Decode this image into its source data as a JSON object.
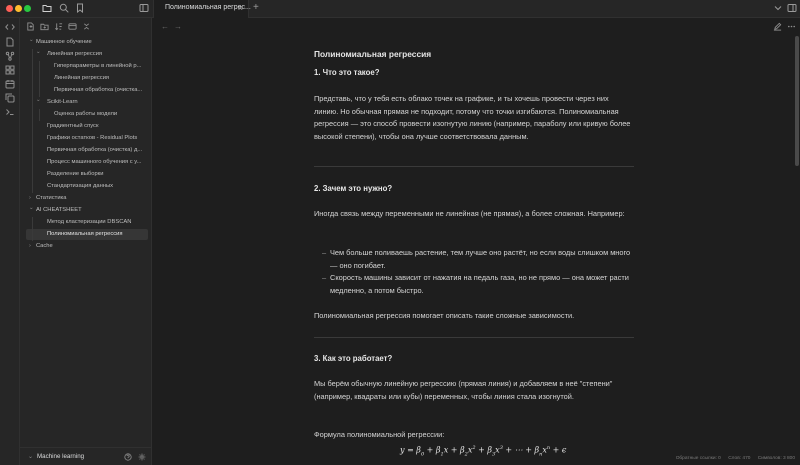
{
  "tab": {
    "title": "Полиномиальная регрес...",
    "close": "×",
    "add": "+"
  },
  "sidebar": {
    "tree": [
      {
        "label": "Машинное обучение",
        "level": 0,
        "folder": true,
        "open": true
      },
      {
        "label": "Линейная регрессия",
        "level": 1,
        "folder": true,
        "open": true
      },
      {
        "label": "Гиперпараметры в линейной р...",
        "level": 2,
        "folder": false
      },
      {
        "label": "Линейная регрессия",
        "level": 2,
        "folder": false
      },
      {
        "label": "Первичная обработка (очистка...",
        "level": 2,
        "folder": false
      },
      {
        "label": "Scikit-Learn",
        "level": 1,
        "folder": true,
        "open": true
      },
      {
        "label": "Оценка работы модели",
        "level": 2,
        "folder": false
      },
      {
        "label": "Градиентный спуск",
        "level": 1,
        "folder": false
      },
      {
        "label": "Графики остатков - Residual Plots",
        "level": 1,
        "folder": false
      },
      {
        "label": "Первичная обработка (очистка) д...",
        "level": 1,
        "folder": false
      },
      {
        "label": "Процесс машинного обучения с у...",
        "level": 1,
        "folder": false
      },
      {
        "label": "Разделение выборки",
        "level": 1,
        "folder": false
      },
      {
        "label": "Стандартизация данных",
        "level": 1,
        "folder": false
      },
      {
        "label": "Статистика",
        "level": 0,
        "folder": true,
        "open": false
      },
      {
        "label": "AI CHEATSHEET",
        "level": 0,
        "folder": true,
        "open": true
      },
      {
        "label": "Метод кластеризации DBSCAN",
        "level": 1,
        "folder": false
      },
      {
        "label": "Полиномиальная регрессия",
        "level": 1,
        "folder": false,
        "active": true
      },
      {
        "label": "Сache",
        "level": 0,
        "folder": true,
        "open": false
      }
    ],
    "vault_name": "Machine learning"
  },
  "note": {
    "title": "Полиномиальная регрессия",
    "h1": "1. Что это такое?",
    "p1": "Представь, что у тебя есть облако точек на графике, и ты хочешь провести через них линию. Но обычная прямая не подходит, потому что точки изгибаются. Полиномиальная регрессия — это способ провести изогнутую линию (например, параболу или кривую более высокой степени), чтобы она лучше соответствовала данным.",
    "h2": "2. Зачем это нужно?",
    "p2": "Иногда связь между переменными не линейная (не прямая), а более сложная. Например:",
    "li1": "Чем больше поливаешь растение, тем лучше оно растёт, но если воды слишком много — оно погибает.",
    "li2": "Скорость машины зависит от нажатия на педаль газа, но не прямо — она может расти медленно, а потом быстро.",
    "p3": "Полиномиальная регрессия помогает описать такие сложные зависимости.",
    "h3": "3. Как это работает?",
    "p4": "Мы берём обычную линейную регрессию (прямая линия) и добавляем в неё \"степени\" (например, квадраты или кубы) переменных, чтобы линия стала изогнутой.",
    "p5": "Формула полиномиальной регрессии:"
  },
  "status": {
    "backlinks": "Обратные ссылки: 0",
    "words": "Слов: 470",
    "chars": "Символов: 3 800"
  },
  "colors": {
    "background": "#1e1e1e",
    "sidebar": "#262626",
    "active_item": "#363636"
  }
}
